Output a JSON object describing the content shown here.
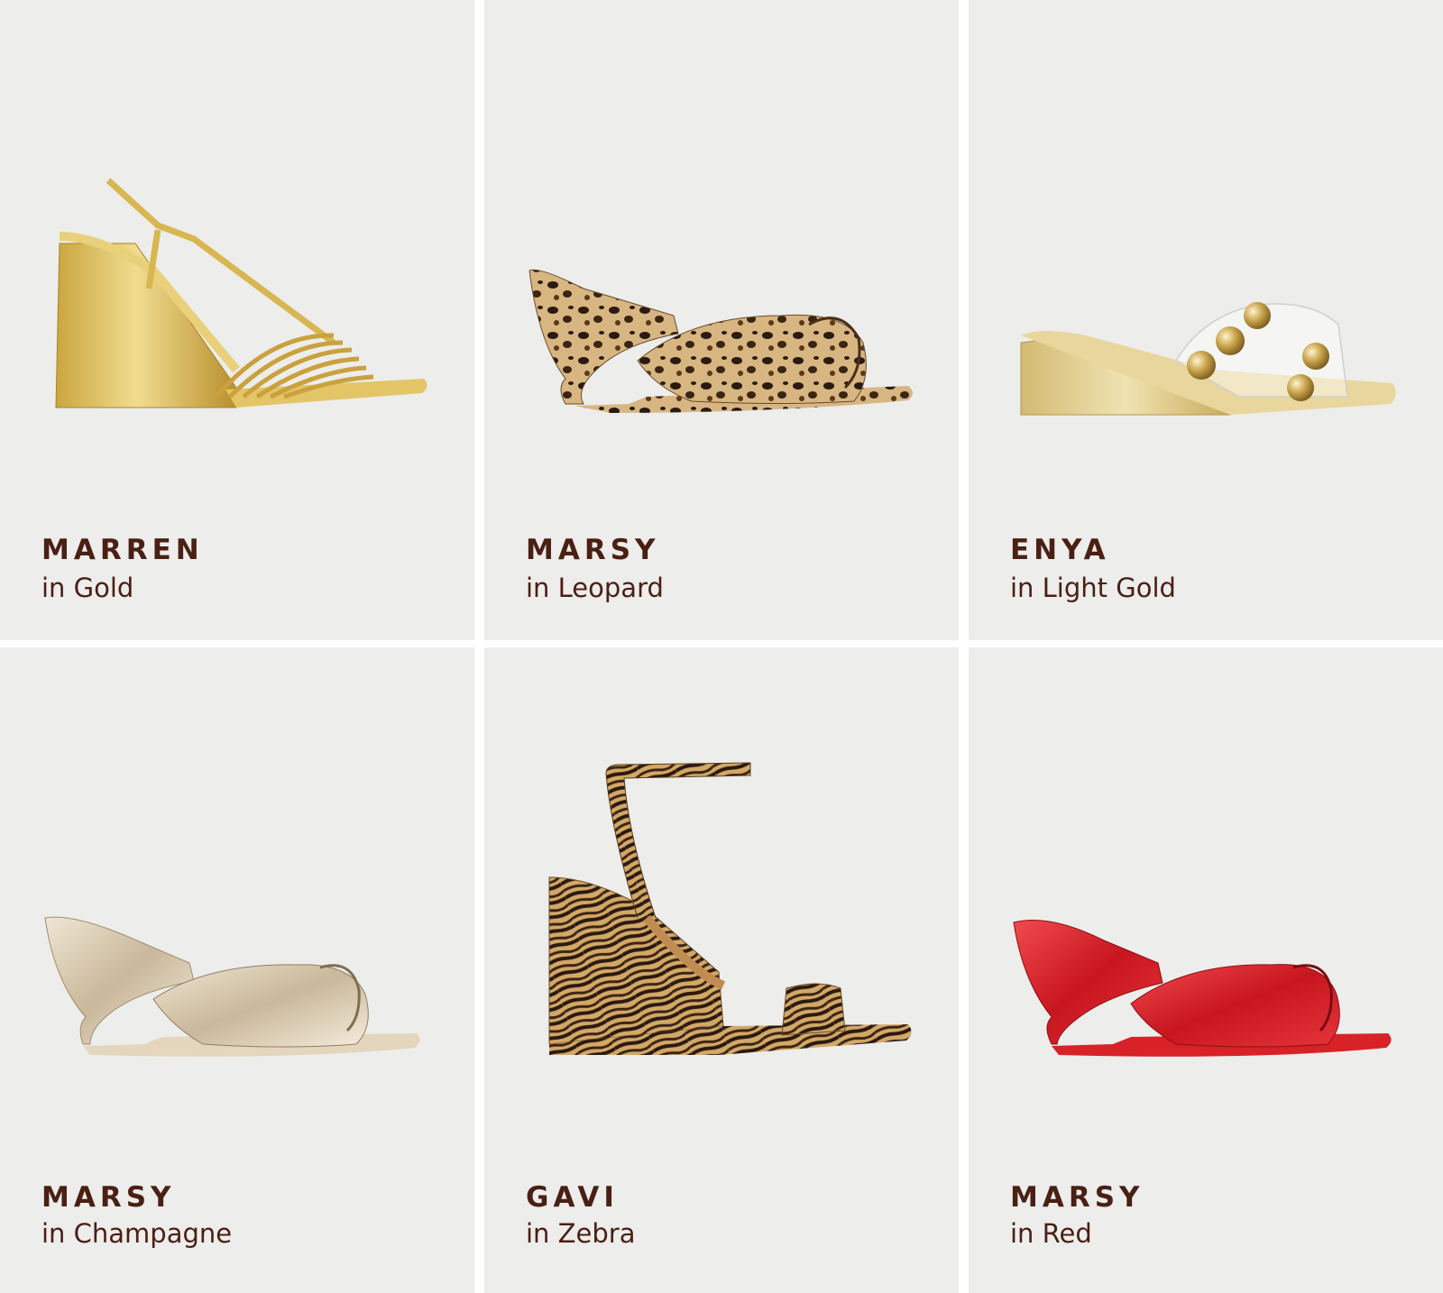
{
  "theme": {
    "text": "#4a1f14",
    "card_bg": "#ededeb",
    "divider": "#ffffff"
  },
  "products": [
    {
      "name": "MARREN",
      "color_label": "in Gold",
      "icon": "gold-strappy-wedge-sandal",
      "swatch": "#d9b85a"
    },
    {
      "name": "MARSY",
      "color_label": "in Leopard",
      "icon": "leopard-knot-wedge-mule",
      "swatch": "#c9a070"
    },
    {
      "name": "ENYA",
      "color_label": "in Light Gold",
      "icon": "studded-clear-wedge-slide",
      "swatch": "#e2cf93"
    },
    {
      "name": "MARSY",
      "color_label": "in Champagne",
      "icon": "champagne-knot-wedge-mule",
      "swatch": "#cdbfa6"
    },
    {
      "name": "GAVI",
      "color_label": "in Zebra",
      "icon": "zebra-ankle-strap-wedge",
      "swatch": "#c08c52"
    },
    {
      "name": "MARSY",
      "color_label": "in Red",
      "icon": "red-knot-wedge-mule",
      "swatch": "#d21e25"
    }
  ]
}
